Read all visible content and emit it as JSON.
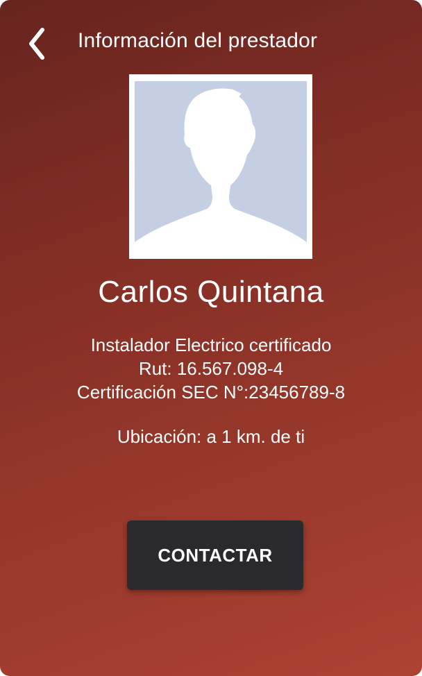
{
  "header": {
    "back_icon": "chevron-left-icon",
    "title": "Información del prestador"
  },
  "provider": {
    "avatar_icon": "person-silhouette-icon",
    "name": "Carlos Quintana",
    "details": [
      "Instalador Electrico certificado",
      "Rut: 16.567.098-4",
      "Certificación SEC N°:23456789-8"
    ],
    "location": "Ubicación: a 1 km. de ti"
  },
  "actions": {
    "contact_label": "CONTACTAR"
  },
  "colors": {
    "background_top": "#67241e",
    "background_bottom": "#ad4232",
    "button": "#2a2a2e",
    "avatar_bg": "#c5cfe3",
    "text": "#ffffff"
  }
}
